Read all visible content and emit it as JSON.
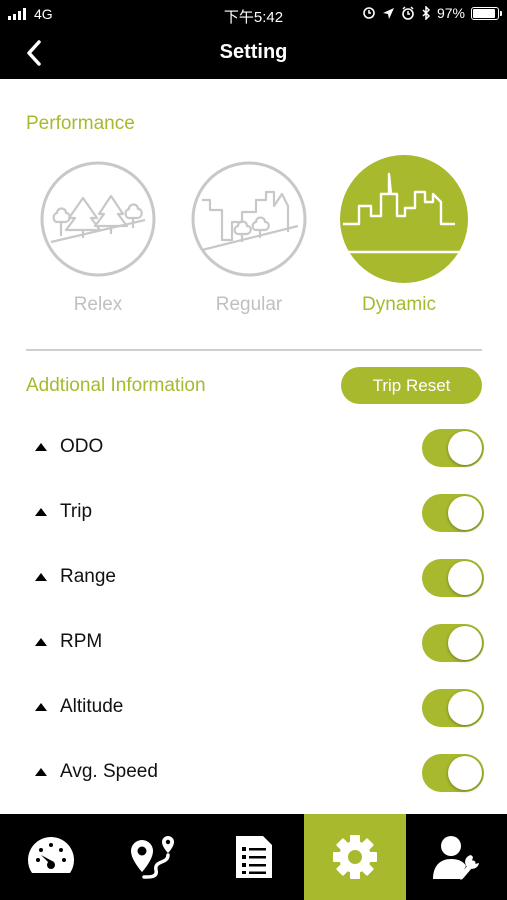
{
  "status_bar": {
    "carrier": "4G",
    "time": "下午5:42",
    "battery": "97%"
  },
  "nav": {
    "title": "Setting"
  },
  "performance": {
    "title": "Performance",
    "modes": [
      {
        "label": "Relex",
        "icon": "forest-icon",
        "active": false
      },
      {
        "label": "Regular",
        "icon": "town-icon",
        "active": false
      },
      {
        "label": "Dynamic",
        "icon": "city-skyline-icon",
        "active": true
      }
    ]
  },
  "additional": {
    "title": "Addtional Information",
    "trip_reset_label": "Trip Reset",
    "items": [
      {
        "label": "ODO",
        "on": true
      },
      {
        "label": "Trip",
        "on": true
      },
      {
        "label": "Range",
        "on": true
      },
      {
        "label": "RPM",
        "on": true
      },
      {
        "label": "Altitude",
        "on": true
      },
      {
        "label": "Avg. Speed",
        "on": true
      }
    ]
  },
  "tabs": [
    {
      "icon": "speedometer-icon",
      "active": false
    },
    {
      "icon": "route-map-icon",
      "active": false
    },
    {
      "icon": "report-list-icon",
      "active": false
    },
    {
      "icon": "gear-icon",
      "active": true
    },
    {
      "icon": "user-settings-icon",
      "active": false
    }
  ],
  "colors": {
    "accent": "#a8b92e",
    "inactive": "#c0c0c0",
    "bar": "#000000"
  }
}
